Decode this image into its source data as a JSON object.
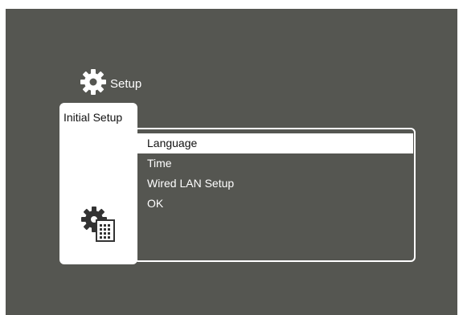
{
  "header": {
    "title": "Setup",
    "icon": "gear-icon"
  },
  "sidebar": {
    "tab_label": "Initial Setup",
    "icon": "setup-document-gear-icon"
  },
  "menu": {
    "items": [
      {
        "label": "Language",
        "selected": true
      },
      {
        "label": "Time",
        "selected": false
      },
      {
        "label": "Wired LAN Setup",
        "selected": false
      },
      {
        "label": "OK",
        "selected": false
      }
    ]
  },
  "colors": {
    "background": "#555651",
    "foreground": "#ffffff",
    "selected_text": "#111111"
  }
}
